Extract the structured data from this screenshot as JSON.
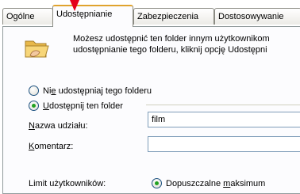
{
  "tabs": [
    {
      "label": "Ogólne"
    },
    {
      "label": "Udostępnianie"
    },
    {
      "label": "Zabezpieczenia"
    },
    {
      "label": "Dostosowywanie"
    }
  ],
  "description": {
    "line1": "Możesz udostępnić ten folder innym użytkownikom",
    "line2": "udostępnianie tego folderu, kliknij opcję Udostępni"
  },
  "share_options": {
    "no_share_prefix": "Ni",
    "no_share_underlined": "e",
    "no_share_rest": " udostępniaj tego folderu",
    "share_underlined": "U",
    "share_rest": "dostępnij ten folder"
  },
  "share_name": {
    "label_underlined": "N",
    "label_rest": "azwa udziału:",
    "value": "film"
  },
  "comment": {
    "label_underlined": "K",
    "label_rest": "omentarz:",
    "value": ""
  },
  "user_limit": {
    "label": "Limit użytkowników:",
    "option_prefix": "Dopuszczalne ",
    "option_underlined": "m",
    "option_rest": "aksimum"
  },
  "colors": {
    "tab_highlight": "#e0a32e",
    "arrow": "#e4001b",
    "radio_dot": "#21a121"
  }
}
